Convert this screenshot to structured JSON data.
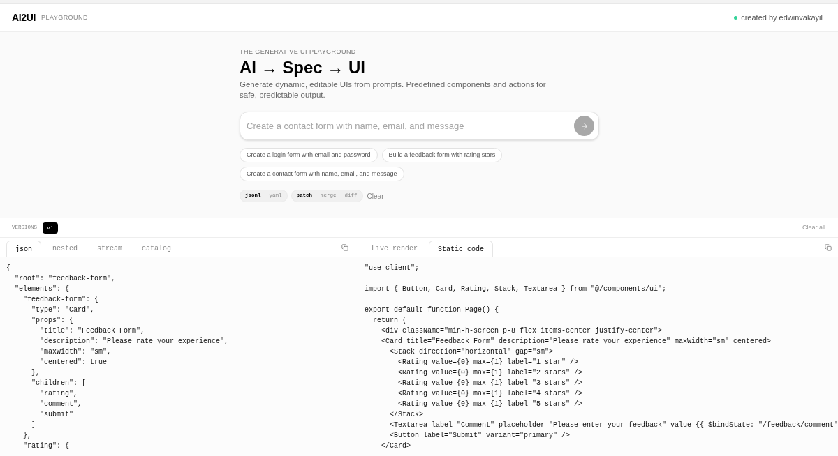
{
  "header": {
    "logo": "AI2UI",
    "subtitle": "PLAYGROUND",
    "credit": "created by edwinvakayil"
  },
  "hero": {
    "eyebrow": "THE GENERATIVE UI PLAYGROUND",
    "title": "AI → Spec → UI",
    "description": "Generate dynamic, editable UIs from prompts. Predefined components and actions for safe, predictable output.",
    "prompt": {
      "placeholder": "Create a contact form with name, email, and message"
    },
    "suggestions": [
      "Create a login form with email and password",
      "Build a feedback form with rating stars",
      "Create a contact form with name, email, and message"
    ],
    "toggle_groups": [
      [
        {
          "label": "jsonl",
          "selected": true
        },
        {
          "label": "yaml",
          "selected": false
        }
      ],
      [
        {
          "label": "patch",
          "selected": true
        },
        {
          "label": "merge",
          "selected": false
        },
        {
          "label": "diff",
          "selected": false
        }
      ]
    ],
    "clear": "Clear"
  },
  "versions": {
    "label": "VERSIONS",
    "items": [
      {
        "label": "v1",
        "selected": true
      }
    ],
    "clear_all": "Clear all"
  },
  "left_panel": {
    "tabs": [
      {
        "label": "json",
        "selected": true
      },
      {
        "label": "nested",
        "selected": false
      },
      {
        "label": "stream",
        "selected": false
      },
      {
        "label": "catalog",
        "selected": false
      }
    ],
    "code": [
      [
        "{",
        "  \"root\": \"feedback-form\",",
        "  \"elements\": {",
        "    \"feedback-form\": {",
        "      \"type\": \"Card\",",
        "      \"props\": {",
        "        \"title\": \"Feedback Form\",",
        "        \"description\": \"Please rate your experience\",",
        "        \"maxWidth\": \"sm\",",
        "        \"centered\": true",
        "      },",
        "      \"children\": [",
        "        \"rating\",",
        "        \"comment\",",
        "        \"submit\"",
        "      ]",
        "    },",
        "    \"rating\": {"
      ]
    ]
  },
  "right_panel": {
    "tabs": [
      {
        "label": "Live render",
        "selected": false
      },
      {
        "label": "Static code",
        "selected": true
      }
    ],
    "code": [
      [
        "\"use client\";"
      ],
      [
        "import { Button, Card, Rating, Stack, Textarea } from \"@/components/ui\";"
      ],
      [
        "export default function Page() {",
        "  return (",
        "    <div className=\"min-h-screen p-8 flex items-center justify-center\">",
        "    <Card title=\"Feedback Form\" description=\"Please rate your experience\" maxWidth=\"sm\" centered>",
        "      <Stack direction=\"horizontal\" gap=\"sm\">",
        "        <Rating value={0} max={1} label=\"1 star\" />",
        "        <Rating value={0} max={1} label=\"2 stars\" />",
        "        <Rating value={0} max={1} label=\"3 stars\" />",
        "        <Rating value={0} max={1} label=\"4 stars\" />",
        "        <Rating value={0} max={1} label=\"5 stars\" />",
        "      </Stack>",
        "      <Textarea label=\"Comment\" placeholder=\"Please enter your feedback\" value={{ $bindState: \"/feedback/comment\"",
        "      <Button label=\"Submit\" variant=\"primary\" />",
        "    </Card>"
      ]
    ]
  }
}
